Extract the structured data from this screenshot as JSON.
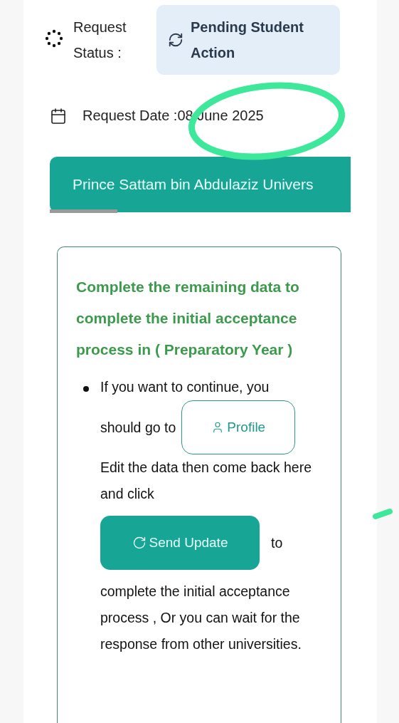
{
  "status": {
    "label": "Request Status :",
    "value": "Pending Student Action"
  },
  "request_date": "Request Date :08 June 2025",
  "tabs": [
    {
      "label": "Prince Sattam bin Abdulaziz Univers",
      "selected": true
    }
  ],
  "notice": {
    "title": "Complete the remaining data to complete the initial acceptance process in ( Preparatory Year )",
    "items": [
      {
        "kind": "text",
        "text": "If you want to continue, you"
      },
      {
        "kind": "row",
        "children": [
          {
            "kind": "text",
            "text": "should go to"
          },
          {
            "kind": "outline_button",
            "label": "Profile"
          }
        ]
      },
      {
        "kind": "text",
        "text": "Edit the data then come back here and click"
      },
      {
        "kind": "row",
        "children": [
          {
            "kind": "filled_button",
            "label": "Send Update"
          },
          {
            "kind": "text",
            "text": "to"
          }
        ]
      },
      {
        "kind": "text",
        "text": "complete the initial acceptance process , Or you can wait for the response from other universities."
      }
    ]
  }
}
